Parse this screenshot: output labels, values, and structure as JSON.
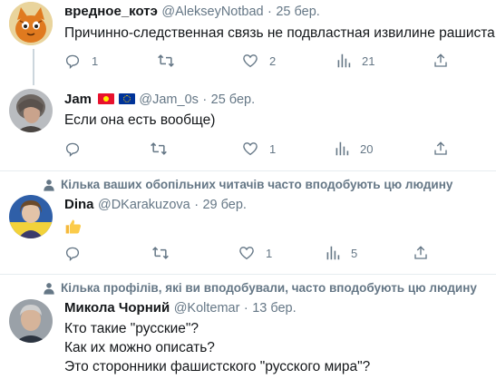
{
  "tweets": [
    {
      "name": "вредное_котэ",
      "handle": "@AlekseyNotbad",
      "sep": "·",
      "date": "25 бер.",
      "text": "Причинно-следственная связь не подвластная извилине рашиста...",
      "replies": "1",
      "retweets": "",
      "likes": "2",
      "views": "21"
    },
    {
      "name": "Jam",
      "handle": "@Jam_0s",
      "sep": "·",
      "date": "25 бер.",
      "text": "Если она есть вообще)",
      "replies": "",
      "retweets": "",
      "likes": "1",
      "views": "20"
    },
    {
      "social": "Кілька ваших обопільних читачів часто вподобують цю людину",
      "name": "Dina",
      "handle": "@DKarakuzova",
      "sep": "·",
      "date": "29 бер.",
      "text": "👍",
      "replies": "",
      "retweets": "",
      "likes": "1",
      "views": "5"
    },
    {
      "social": "Кілька профілів, які ви вподобували, часто вподобують цю людину",
      "name": "Микола Чорний",
      "handle": "@Koltemar",
      "sep": "·",
      "date": "13 бер.",
      "lines": [
        "Кто такие \"русские\"?",
        "Как их можно описать?",
        "Это сторонники фашистского \"русского мира\"?"
      ]
    }
  ],
  "colors": {
    "muted": "#657786",
    "text": "#14171a",
    "divider": "#e6ecf0"
  },
  "icons": [
    "reply-icon",
    "retweet-icon",
    "like-icon",
    "views-icon",
    "share-icon",
    "person-icon",
    "kyrgyz-flag-icon",
    "eu-flag-icon",
    "thumbs-up-icon"
  ]
}
